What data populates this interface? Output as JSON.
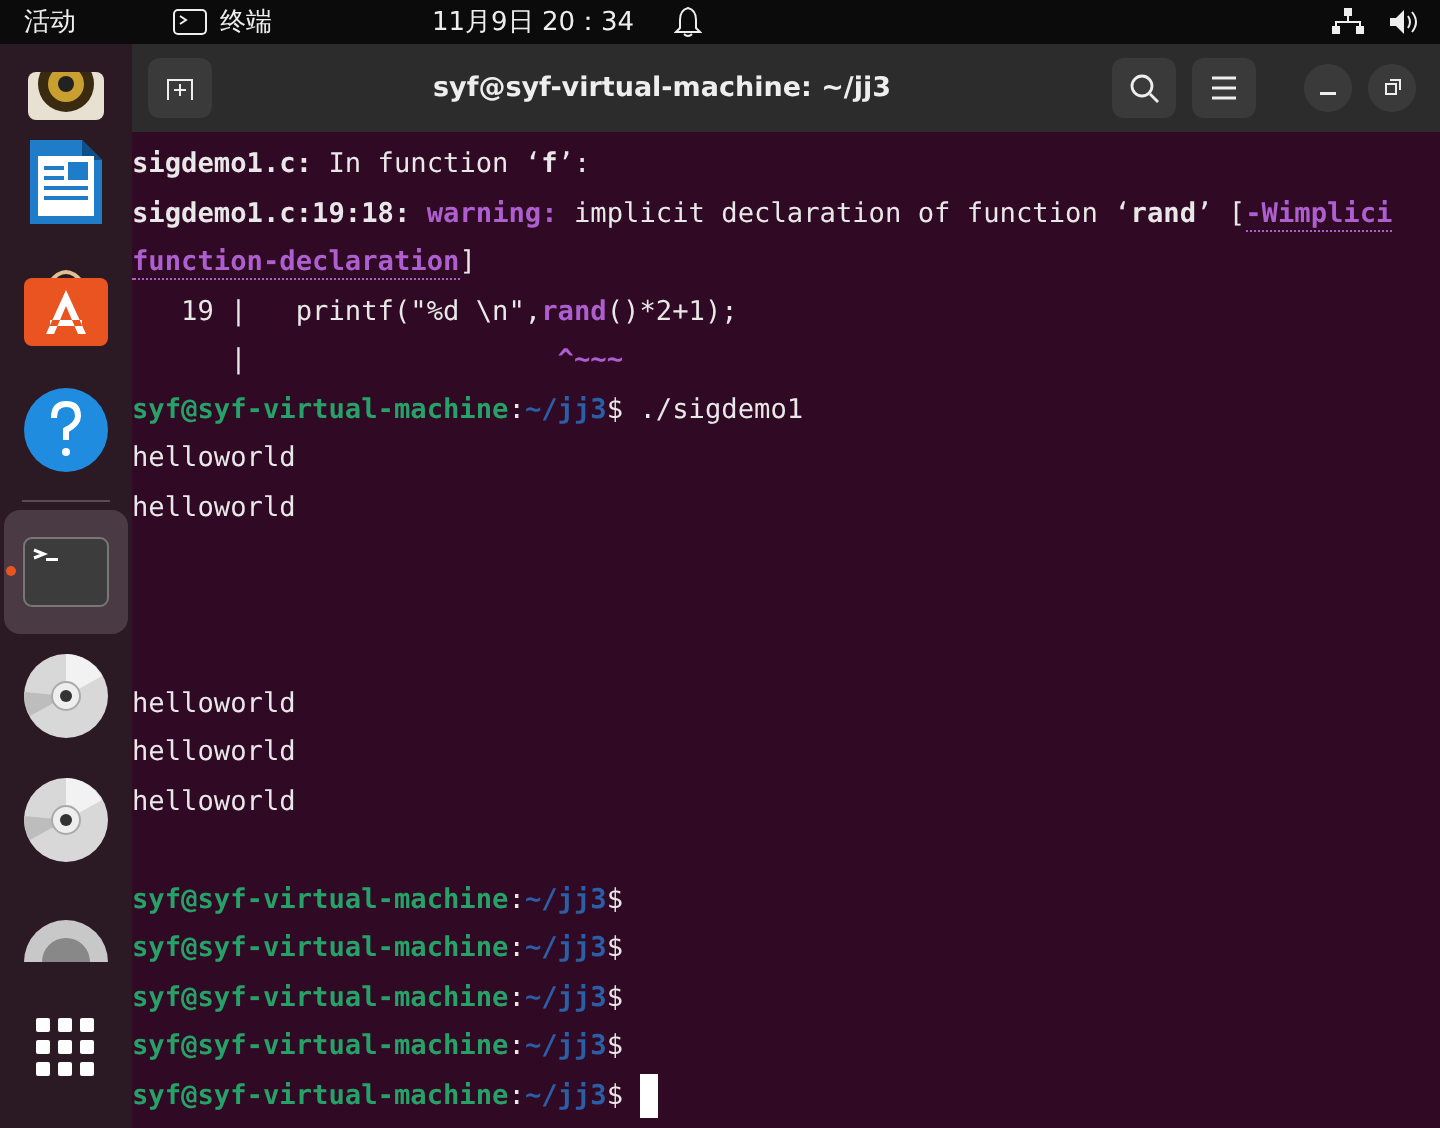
{
  "top_bar": {
    "activities": "活动",
    "app_name": "终端",
    "clock": "11月9日 20：34"
  },
  "dock": {
    "items": [
      {
        "kind": "speaker",
        "active": false
      },
      {
        "kind": "writer",
        "active": false
      },
      {
        "kind": "store",
        "active": false
      },
      {
        "kind": "help",
        "active": false
      },
      {
        "kind": "terminal",
        "active": true
      },
      {
        "kind": "disc",
        "active": false
      },
      {
        "kind": "disc",
        "active": false
      },
      {
        "kind": "disc-partial",
        "active": false
      },
      {
        "kind": "apps",
        "active": false
      }
    ]
  },
  "window": {
    "title": "syf@syf-virtual-machine: ~/jj3"
  },
  "terminal": {
    "lines": [
      {
        "kind": "text",
        "segments": [
          {
            "kind": "bold",
            "text": "sigdemo1.c:"
          },
          {
            "kind": "plain",
            "text": " In function ‘"
          },
          {
            "kind": "bold",
            "text": "f"
          },
          {
            "kind": "plain",
            "text": "’:"
          }
        ]
      },
      {
        "kind": "text",
        "segments": [
          {
            "kind": "bold",
            "text": "sigdemo1.c:19:18: "
          },
          {
            "kind": "warning",
            "text": "warning:"
          },
          {
            "kind": "plain",
            "text": " implicit declaration of function ‘"
          },
          {
            "kind": "bold",
            "text": "rand"
          },
          {
            "kind": "plain",
            "text": "’ ["
          },
          {
            "kind": "option",
            "text": "-Wimplici"
          }
        ]
      },
      {
        "kind": "text",
        "segments": [
          {
            "kind": "option",
            "text": "function-declaration"
          },
          {
            "kind": "plain",
            "text": "]"
          }
        ]
      },
      {
        "kind": "text",
        "segments": [
          {
            "kind": "plain",
            "text": "   19 |   printf(\"%d \\n\","
          },
          {
            "kind": "warning",
            "text": "rand"
          },
          {
            "kind": "plain",
            "text": "()*2+1);"
          }
        ]
      },
      {
        "kind": "text",
        "segments": [
          {
            "kind": "plain",
            "text": "      |                   "
          },
          {
            "kind": "warning",
            "text": "^~~~"
          }
        ]
      },
      {
        "kind": "text",
        "segments": [
          {
            "kind": "user",
            "text": "syf@syf-virtual-machine"
          },
          {
            "kind": "plain",
            "text": ":"
          },
          {
            "kind": "path",
            "text": "~/jj3"
          },
          {
            "kind": "plain",
            "text": "$ ./sigdemo1"
          }
        ]
      },
      {
        "kind": "text",
        "segments": [
          {
            "kind": "plain",
            "text": "helloworld"
          }
        ]
      },
      {
        "kind": "text",
        "segments": [
          {
            "kind": "plain",
            "text": "helloworld"
          }
        ]
      },
      {
        "kind": "blank"
      },
      {
        "kind": "blank"
      },
      {
        "kind": "blank"
      },
      {
        "kind": "text",
        "segments": [
          {
            "kind": "plain",
            "text": "helloworld"
          }
        ]
      },
      {
        "kind": "text",
        "segments": [
          {
            "kind": "plain",
            "text": "helloworld"
          }
        ]
      },
      {
        "kind": "text",
        "segments": [
          {
            "kind": "plain",
            "text": "helloworld"
          }
        ]
      },
      {
        "kind": "blank"
      },
      {
        "kind": "text",
        "segments": [
          {
            "kind": "user",
            "text": "syf@syf-virtual-machine"
          },
          {
            "kind": "plain",
            "text": ":"
          },
          {
            "kind": "path",
            "text": "~/jj3"
          },
          {
            "kind": "plain",
            "text": "$"
          }
        ]
      },
      {
        "kind": "text",
        "segments": [
          {
            "kind": "user",
            "text": "syf@syf-virtual-machine"
          },
          {
            "kind": "plain",
            "text": ":"
          },
          {
            "kind": "path",
            "text": "~/jj3"
          },
          {
            "kind": "plain",
            "text": "$"
          }
        ]
      },
      {
        "kind": "text",
        "segments": [
          {
            "kind": "user",
            "text": "syf@syf-virtual-machine"
          },
          {
            "kind": "plain",
            "text": ":"
          },
          {
            "kind": "path",
            "text": "~/jj3"
          },
          {
            "kind": "plain",
            "text": "$"
          }
        ]
      },
      {
        "kind": "text",
        "segments": [
          {
            "kind": "user",
            "text": "syf@syf-virtual-machine"
          },
          {
            "kind": "plain",
            "text": ":"
          },
          {
            "kind": "path",
            "text": "~/jj3"
          },
          {
            "kind": "plain",
            "text": "$"
          }
        ]
      },
      {
        "kind": "text",
        "segments": [
          {
            "kind": "user",
            "text": "syf@syf-virtual-machine"
          },
          {
            "kind": "plain",
            "text": ":"
          },
          {
            "kind": "path",
            "text": "~/jj3"
          },
          {
            "kind": "plain",
            "text": "$"
          }
        ]
      }
    ],
    "cursor_visible": true
  }
}
